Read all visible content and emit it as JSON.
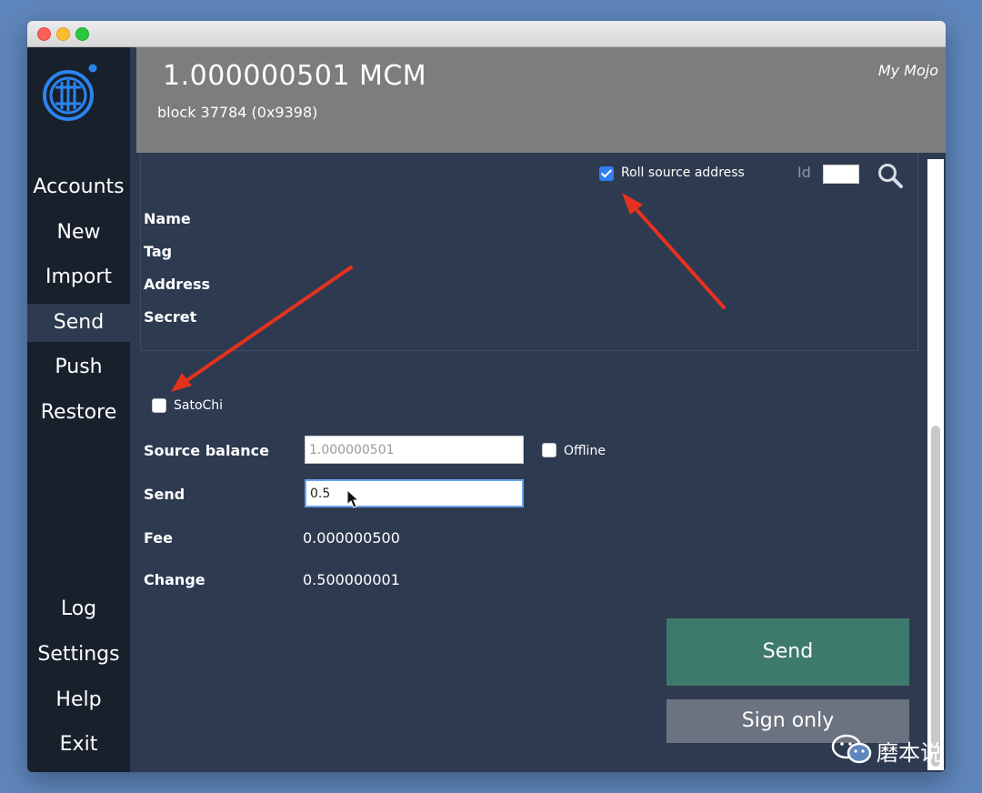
{
  "header": {
    "balance": "1.000000501 MCM",
    "block": "block 37784 (0x9398)",
    "wallet_name": "My Mojo"
  },
  "sidebar": {
    "items": [
      {
        "label": "Accounts"
      },
      {
        "label": "New"
      },
      {
        "label": "Import"
      },
      {
        "label": "Send",
        "active": true
      },
      {
        "label": "Push"
      },
      {
        "label": "Restore"
      },
      {
        "label": "Log"
      },
      {
        "label": "Settings"
      },
      {
        "label": "Help"
      },
      {
        "label": "Exit"
      }
    ]
  },
  "source": {
    "roll_label": "Roll source address",
    "roll_checked": true,
    "id_label": "Id",
    "labels": {
      "name": "Name",
      "tag": "Tag",
      "address": "Address",
      "secret": "Secret"
    }
  },
  "form": {
    "satochi_label": "SatoChi",
    "satochi_checked": false,
    "source_balance_label": "Source balance",
    "source_balance_value": "1.000000501",
    "offline_label": "Offline",
    "offline_checked": false,
    "send_label": "Send",
    "send_value": "0.5",
    "fee_label": "Fee",
    "fee_value": "0.000000500",
    "change_label": "Change",
    "change_value": "0.500000001"
  },
  "buttons": {
    "send": "Send",
    "sign_only": "Sign only"
  },
  "watermark": {
    "text": "磨本说"
  },
  "colors": {
    "sidebar": "#18202c",
    "content": "#2e3a50",
    "header": "#7d7d7d",
    "send_button": "#3e7a6b",
    "sign_button": "#6c7380",
    "checkbox_accent": "#2f7ff1",
    "annotation_arrow": "#e5321e"
  }
}
